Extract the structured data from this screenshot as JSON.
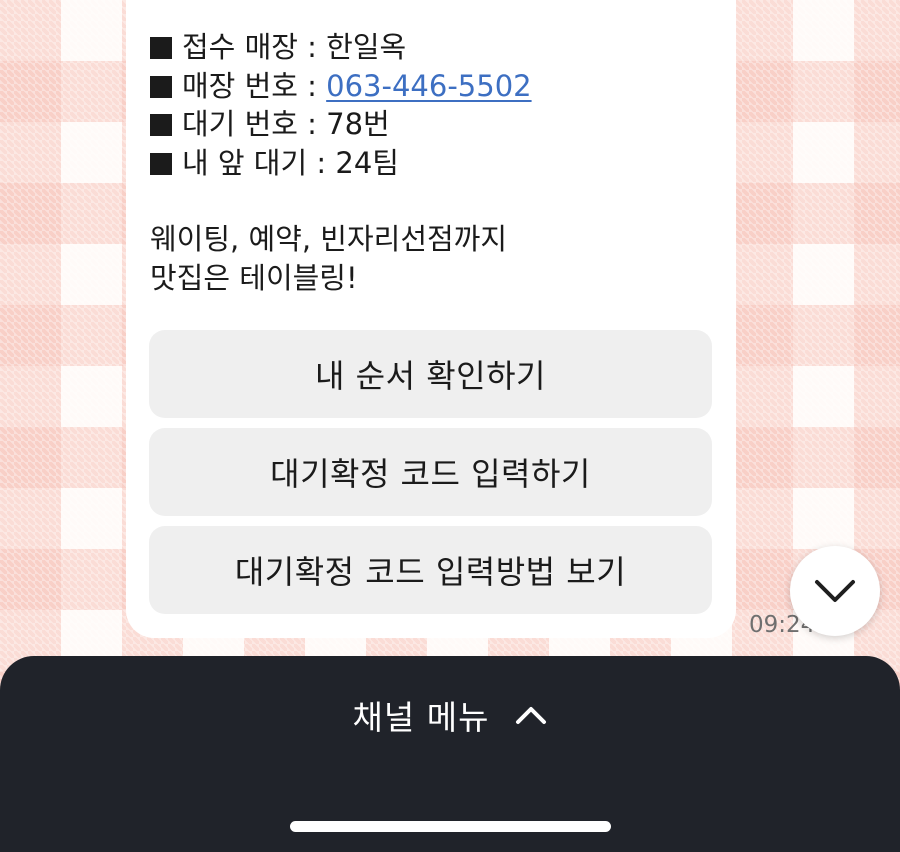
{
  "message": {
    "info": [
      {
        "label": "접수 매장 : ",
        "value": "한일옥"
      },
      {
        "label": "매장 번호 : ",
        "value": "063-446-5502"
      },
      {
        "label": "대기 번호 : ",
        "value": "78번"
      },
      {
        "label": "내 앞 대기 : ",
        "value": "24팀"
      }
    ],
    "promo_line1": "웨이팅, 예약, 빈자리선점까지",
    "promo_line2": "맛집은 테이블링!",
    "buttons": {
      "check_order": "내 순서 확인하기",
      "enter_code": "대기확정 코드 입력하기",
      "view_code_method": "대기확정 코드 입력방법 보기"
    },
    "timestamp": "09:24"
  },
  "channel_menu": {
    "label": "채널 메뉴"
  },
  "icons": {
    "scroll_down": "chevron-down-icon",
    "menu_toggle": "chevron-up-icon"
  },
  "colors": {
    "link": "#3d6fc2",
    "menu_background": "#20232a",
    "button_background": "#efefef"
  }
}
